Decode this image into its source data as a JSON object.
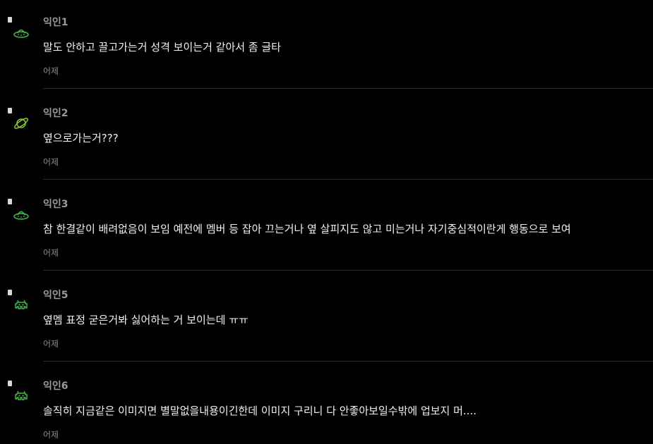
{
  "colors": {
    "background": "#000000",
    "nickname": "#9a9a9a",
    "body_text": "#f2f2f2",
    "timestamp": "#8a8a8a",
    "divider": "#2a2a2a",
    "avatar_green": "#3fbf4a",
    "avatar_lime": "#8acb2a"
  },
  "comments": [
    {
      "nickname": "익인1",
      "text": "말도 안하고 끌고가는거 성격 보이는거 같아서 좀 글타",
      "time": "어제",
      "avatar_icon": "ufo-icon"
    },
    {
      "nickname": "익인2",
      "text": "옆으로가는거???",
      "time": "어제",
      "avatar_icon": "planet-icon"
    },
    {
      "nickname": "익인3",
      "text": "참 한결같이 배려없음이 보임 예전에 멤버 등 잡아 끄는거나 옆 살피지도 않고 미는거나 자기중심적이란게 행동으로 보여",
      "time": "어제",
      "avatar_icon": "ufo-icon"
    },
    {
      "nickname": "익인5",
      "text": "옆멤 표정 굳은거봐 싫어하는 거 보이는데 ㅠㅠ",
      "time": "어제",
      "avatar_icon": "space-invader-icon"
    },
    {
      "nickname": "익인6",
      "text": "솔직히 지금같은 이미지면 별말없을내용이긴한데 이미지 구리니 다 안좋아보일수밖에 업보지 머....",
      "time": "어제",
      "avatar_icon": "space-invader-icon"
    }
  ]
}
